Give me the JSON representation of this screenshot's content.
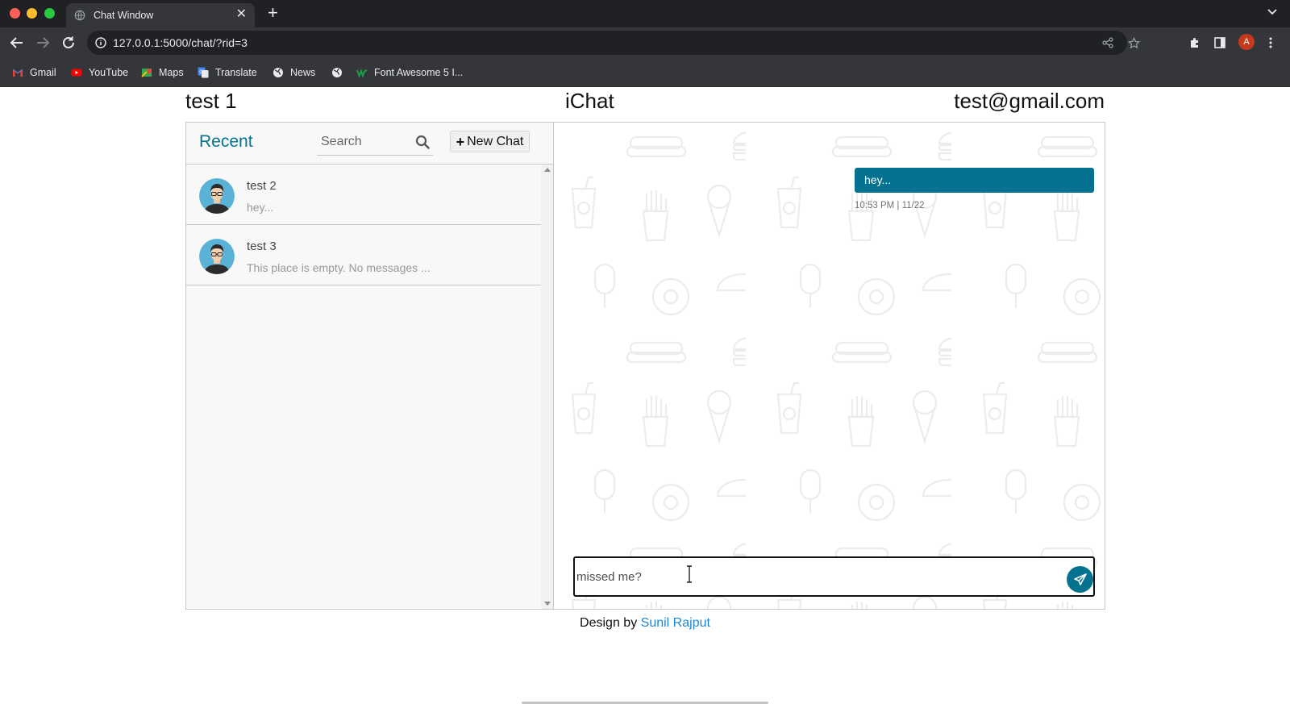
{
  "browser": {
    "tab_title": "Chat Window",
    "url": "127.0.0.1:5000/chat/?rid=3",
    "profile_initial": "A",
    "bookmarks": [
      {
        "label": "Gmail",
        "icon": "gmail-icon"
      },
      {
        "label": "YouTube",
        "icon": "youtube-icon"
      },
      {
        "label": "Maps",
        "icon": "maps-icon"
      },
      {
        "label": "Translate",
        "icon": "translate-icon"
      },
      {
        "label": "News",
        "icon": "globe-icon"
      },
      {
        "label": "",
        "icon": "globe-icon"
      },
      {
        "label": "Font Awesome 5 I...",
        "icon": "font-awesome-icon"
      }
    ]
  },
  "header": {
    "user": "test 1",
    "app_name": "iChat",
    "email": "test@gmail.com"
  },
  "sidebar": {
    "heading": "Recent",
    "search_placeholder": "Search",
    "new_chat_label": "New Chat",
    "chats": [
      {
        "name": "test 2",
        "preview": "hey..."
      },
      {
        "name": "test 3",
        "preview": "This place is empty. No messages ..."
      }
    ]
  },
  "conversation": {
    "messages": [
      {
        "direction": "outgoing",
        "text": "hey...",
        "time": "10:53 PM | 11/22"
      }
    ],
    "compose_value": "missed me?"
  },
  "footer": {
    "prefix": "Design by",
    "author": "Sunil Rajput"
  },
  "colors": {
    "accent": "#05728f",
    "link": "#1b87d6",
    "chrome_dark": "#202124",
    "chrome": "#35363a"
  }
}
